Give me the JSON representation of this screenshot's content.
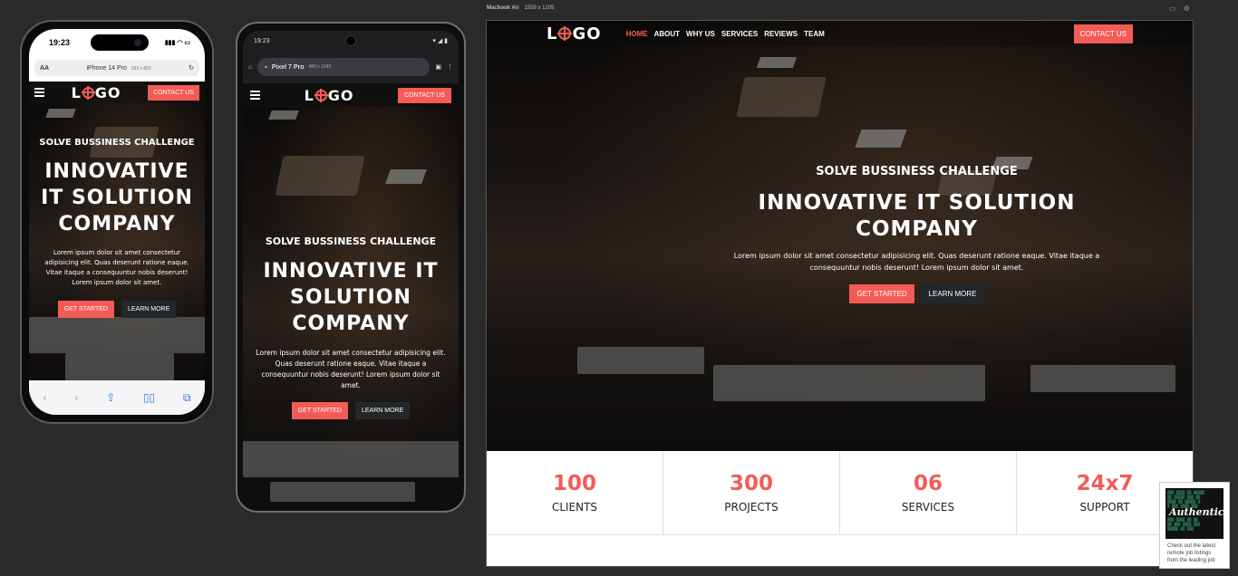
{
  "iphone": {
    "time": "19:23",
    "device_label": "iPhone 14 Pro",
    "device_size": "393 x 852",
    "text_size": "AA",
    "nav_cta": "CONTACT US"
  },
  "pixel": {
    "time": "19:23",
    "device_label": "Pixel 7 Pro",
    "device_size": "480 x 1040",
    "nav_cta": "CONTACT US"
  },
  "desktop": {
    "device_label": "Macbook Air",
    "device_size": "1559 x 1205",
    "menu": [
      "HOME",
      "ABOUT",
      "WHY US",
      "SERVICES",
      "REVIEWS",
      "TEAM"
    ],
    "active_menu": "HOME",
    "nav_cta": "CONTACT US"
  },
  "site": {
    "logo_left": "L",
    "logo_right": "GO",
    "subtitle": "SOLVE BUSSINESS CHALLENGE",
    "title": "INNOVATIVE IT SOLUTION COMPANY",
    "title_mobile_lines": [
      "INNOVATIVE",
      "IT SOLUTION",
      "COMPANY"
    ],
    "title_pixel_lines": [
      "INNOVATIVE IT",
      "SOLUTION",
      "COMPANY"
    ],
    "title_desktop_lines": [
      "INNOVATIVE IT SOLUTION",
      "COMPANY"
    ],
    "paragraph": "Lorem ipsum dolor sit amet consectetur adipisicing elit. Quas deserunt ratione eaque. Vitae itaque a consequuntur nobis deserunt! Lorem ipsum dolor sit amet.",
    "primary_cta": "GET STARTED",
    "secondary_cta": "LEARN MORE"
  },
  "stats": [
    {
      "value": "100",
      "label": "CLIENTS"
    },
    {
      "value": "300",
      "label": "PROJECTS"
    },
    {
      "value": "06",
      "label": "SERVICES"
    },
    {
      "value": "24x7",
      "label": "SUPPORT"
    }
  ],
  "ad": {
    "image_text": "Authentic",
    "text": "Check out the latest remote job listings from the leading job"
  },
  "colors": {
    "accent": "#f45b57",
    "dark_button": "#232729",
    "background": "#2a2a2a"
  }
}
